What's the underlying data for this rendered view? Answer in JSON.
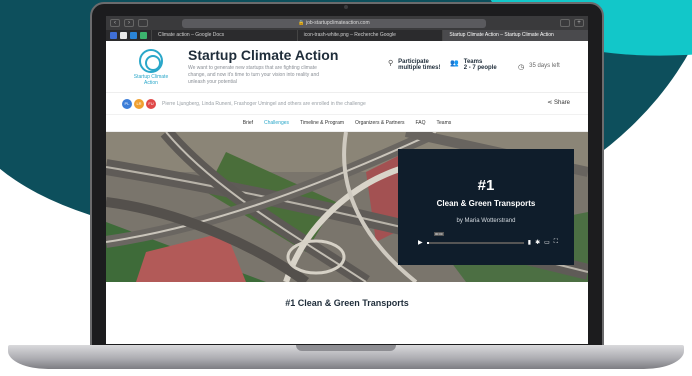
{
  "browser": {
    "url": "🔒 job-startupclimateaction.com",
    "tabs": [
      {
        "label": "Climate action – Google Docs",
        "active": false
      },
      {
        "label": "icon-trash-white.png – Recherche Google",
        "active": false
      },
      {
        "label": "Startup Climate Action – Startup Climate Action",
        "active": true
      }
    ]
  },
  "header": {
    "logo_text": "Startup Climate Action",
    "title": "Startup Climate Action",
    "description": "We want to generate new startups that are fighting climate change, and now it's time to turn your vision into reality and unleash your potential",
    "participate_label": "Participate",
    "participate_sub": "multiple times!",
    "teams_label": "Teams",
    "teams_sub": "2 - 7 people",
    "days_left": "35 days left"
  },
  "participants": {
    "avatars": [
      {
        "initials": "PL",
        "color": "#3b7dd8"
      },
      {
        "initials": "LR",
        "color": "#f0a030"
      },
      {
        "initials": "FU",
        "color": "#e04848"
      }
    ],
    "text": "Pierre Ljungberg, Linda Runeni, Frashoger Umingel and others are enrolled in the challenge",
    "share_label": "Share"
  },
  "nav": {
    "items": [
      "Brief",
      "Challenges",
      "Timeline & Program",
      "Organizers & Partners",
      "FAQ",
      "Teams"
    ],
    "active": "Challenges"
  },
  "video_card": {
    "number": "#1",
    "title": "Clean & Green Transports",
    "author": "by Maria Wotterstrand",
    "time": "00:00"
  },
  "section": {
    "title": "#1 Clean & Green Transports"
  },
  "colors": {
    "teal_bg": "#0d4f5c",
    "cyan_accent": "#12c7c9",
    "brand_blue": "#2aa7c9",
    "card_bg": "#0f1d2b"
  }
}
